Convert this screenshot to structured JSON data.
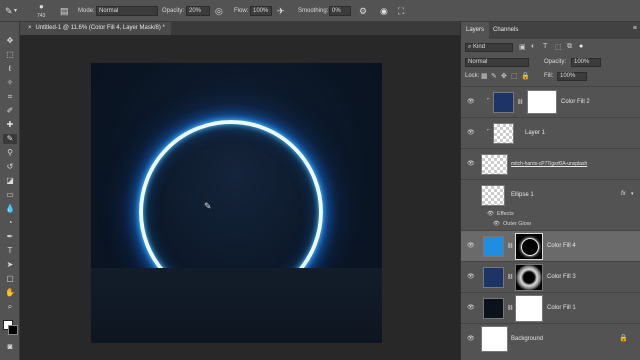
{
  "options_bar": {
    "brush_size": "743",
    "mode_label": "Mode:",
    "mode_value": "Normal",
    "opacity_label": "Opacity:",
    "opacity_value": "20%",
    "flow_label": "Flow:",
    "flow_value": "100%",
    "smoothing_label": "Smoothing:",
    "smoothing_value": "0%"
  },
  "document_tab": {
    "title": "Untitled-1 @ 11.6% (Color Fill 4, Layer Mask/8) *",
    "close_glyph": "×"
  },
  "panel": {
    "tabs": [
      "Layers",
      "Channels"
    ],
    "filter_kind": "Kind",
    "blend_mode": "Normal",
    "opacity_label": "Opacity:",
    "opacity_value": "100%",
    "lock_label": "Lock:",
    "fill_label": "Fill:",
    "fill_value": "100%"
  },
  "layers": [
    {
      "name": "Color Fill 2",
      "thumb": "navy-fill",
      "mask": "white",
      "selected": false
    },
    {
      "name": "Layer 1",
      "thumb": "transparent",
      "mask": "",
      "selected": false
    },
    {
      "name": "mitch-harris-cP7Tigsrl0A-unsplash",
      "thumb": "transparent",
      "mask": "",
      "selected": false
    },
    {
      "name": "Ellipse 1",
      "thumb": "transparent",
      "mask": "",
      "selected": false,
      "fx": "fx"
    },
    {
      "name": "Color Fill 4",
      "thumb": "blue-fill",
      "mask": "ring-mask",
      "selected": true
    },
    {
      "name": "Color Fill 3",
      "thumb": "navy-fill",
      "mask": "soft-ring-mask",
      "selected": false
    },
    {
      "name": "Color Fill 1",
      "thumb": "dark-fill",
      "mask": "white",
      "selected": false
    },
    {
      "name": "Background",
      "thumb": "white",
      "mask": "",
      "selected": false
    }
  ],
  "effects": {
    "label": "Effects",
    "outer_glow": "Outer Glow"
  },
  "colors": {
    "glow": "#1a8cff",
    "ring_core": "#e8fbff",
    "panel": "#535353"
  }
}
